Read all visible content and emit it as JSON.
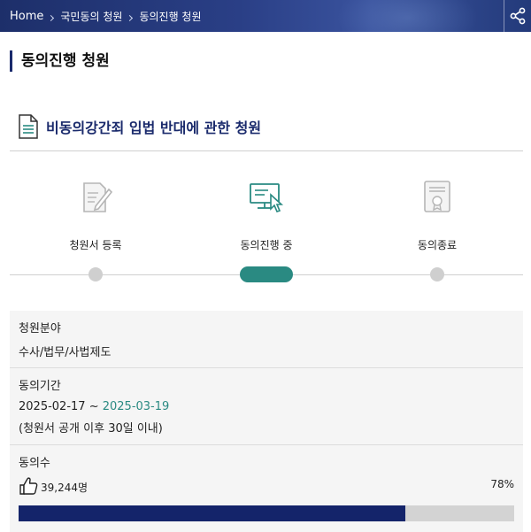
{
  "breadcrumb": {
    "home": "Home",
    "level1": "국민동의 청원",
    "level2": "동의진행 청원"
  },
  "page_title": "동의진행 청원",
  "petition_title": "비동의강간죄 입법 반대에 관한 청원",
  "stages": [
    {
      "label": "청원서 등록",
      "icon": "document-pen-icon"
    },
    {
      "label": "동의진행 중",
      "icon": "computer-click-icon"
    },
    {
      "label": "동의종료",
      "icon": "certificate-icon"
    }
  ],
  "current_stage_index": 1,
  "field": {
    "label": "청원분야",
    "value": "수사/법무/사법제도"
  },
  "period": {
    "label": "동의기간",
    "start": "2025-02-17",
    "separator": " ~ ",
    "end": "2025-03-19",
    "note": "(청원서 공개 이후 30일 이내)"
  },
  "consent": {
    "label": "동의수",
    "count": "39,244명",
    "percent_text": "78%",
    "percent": 78
  },
  "colors": {
    "navy": "#14246a",
    "teal": "#2a8a82",
    "inactive": "#cfcfcf"
  }
}
